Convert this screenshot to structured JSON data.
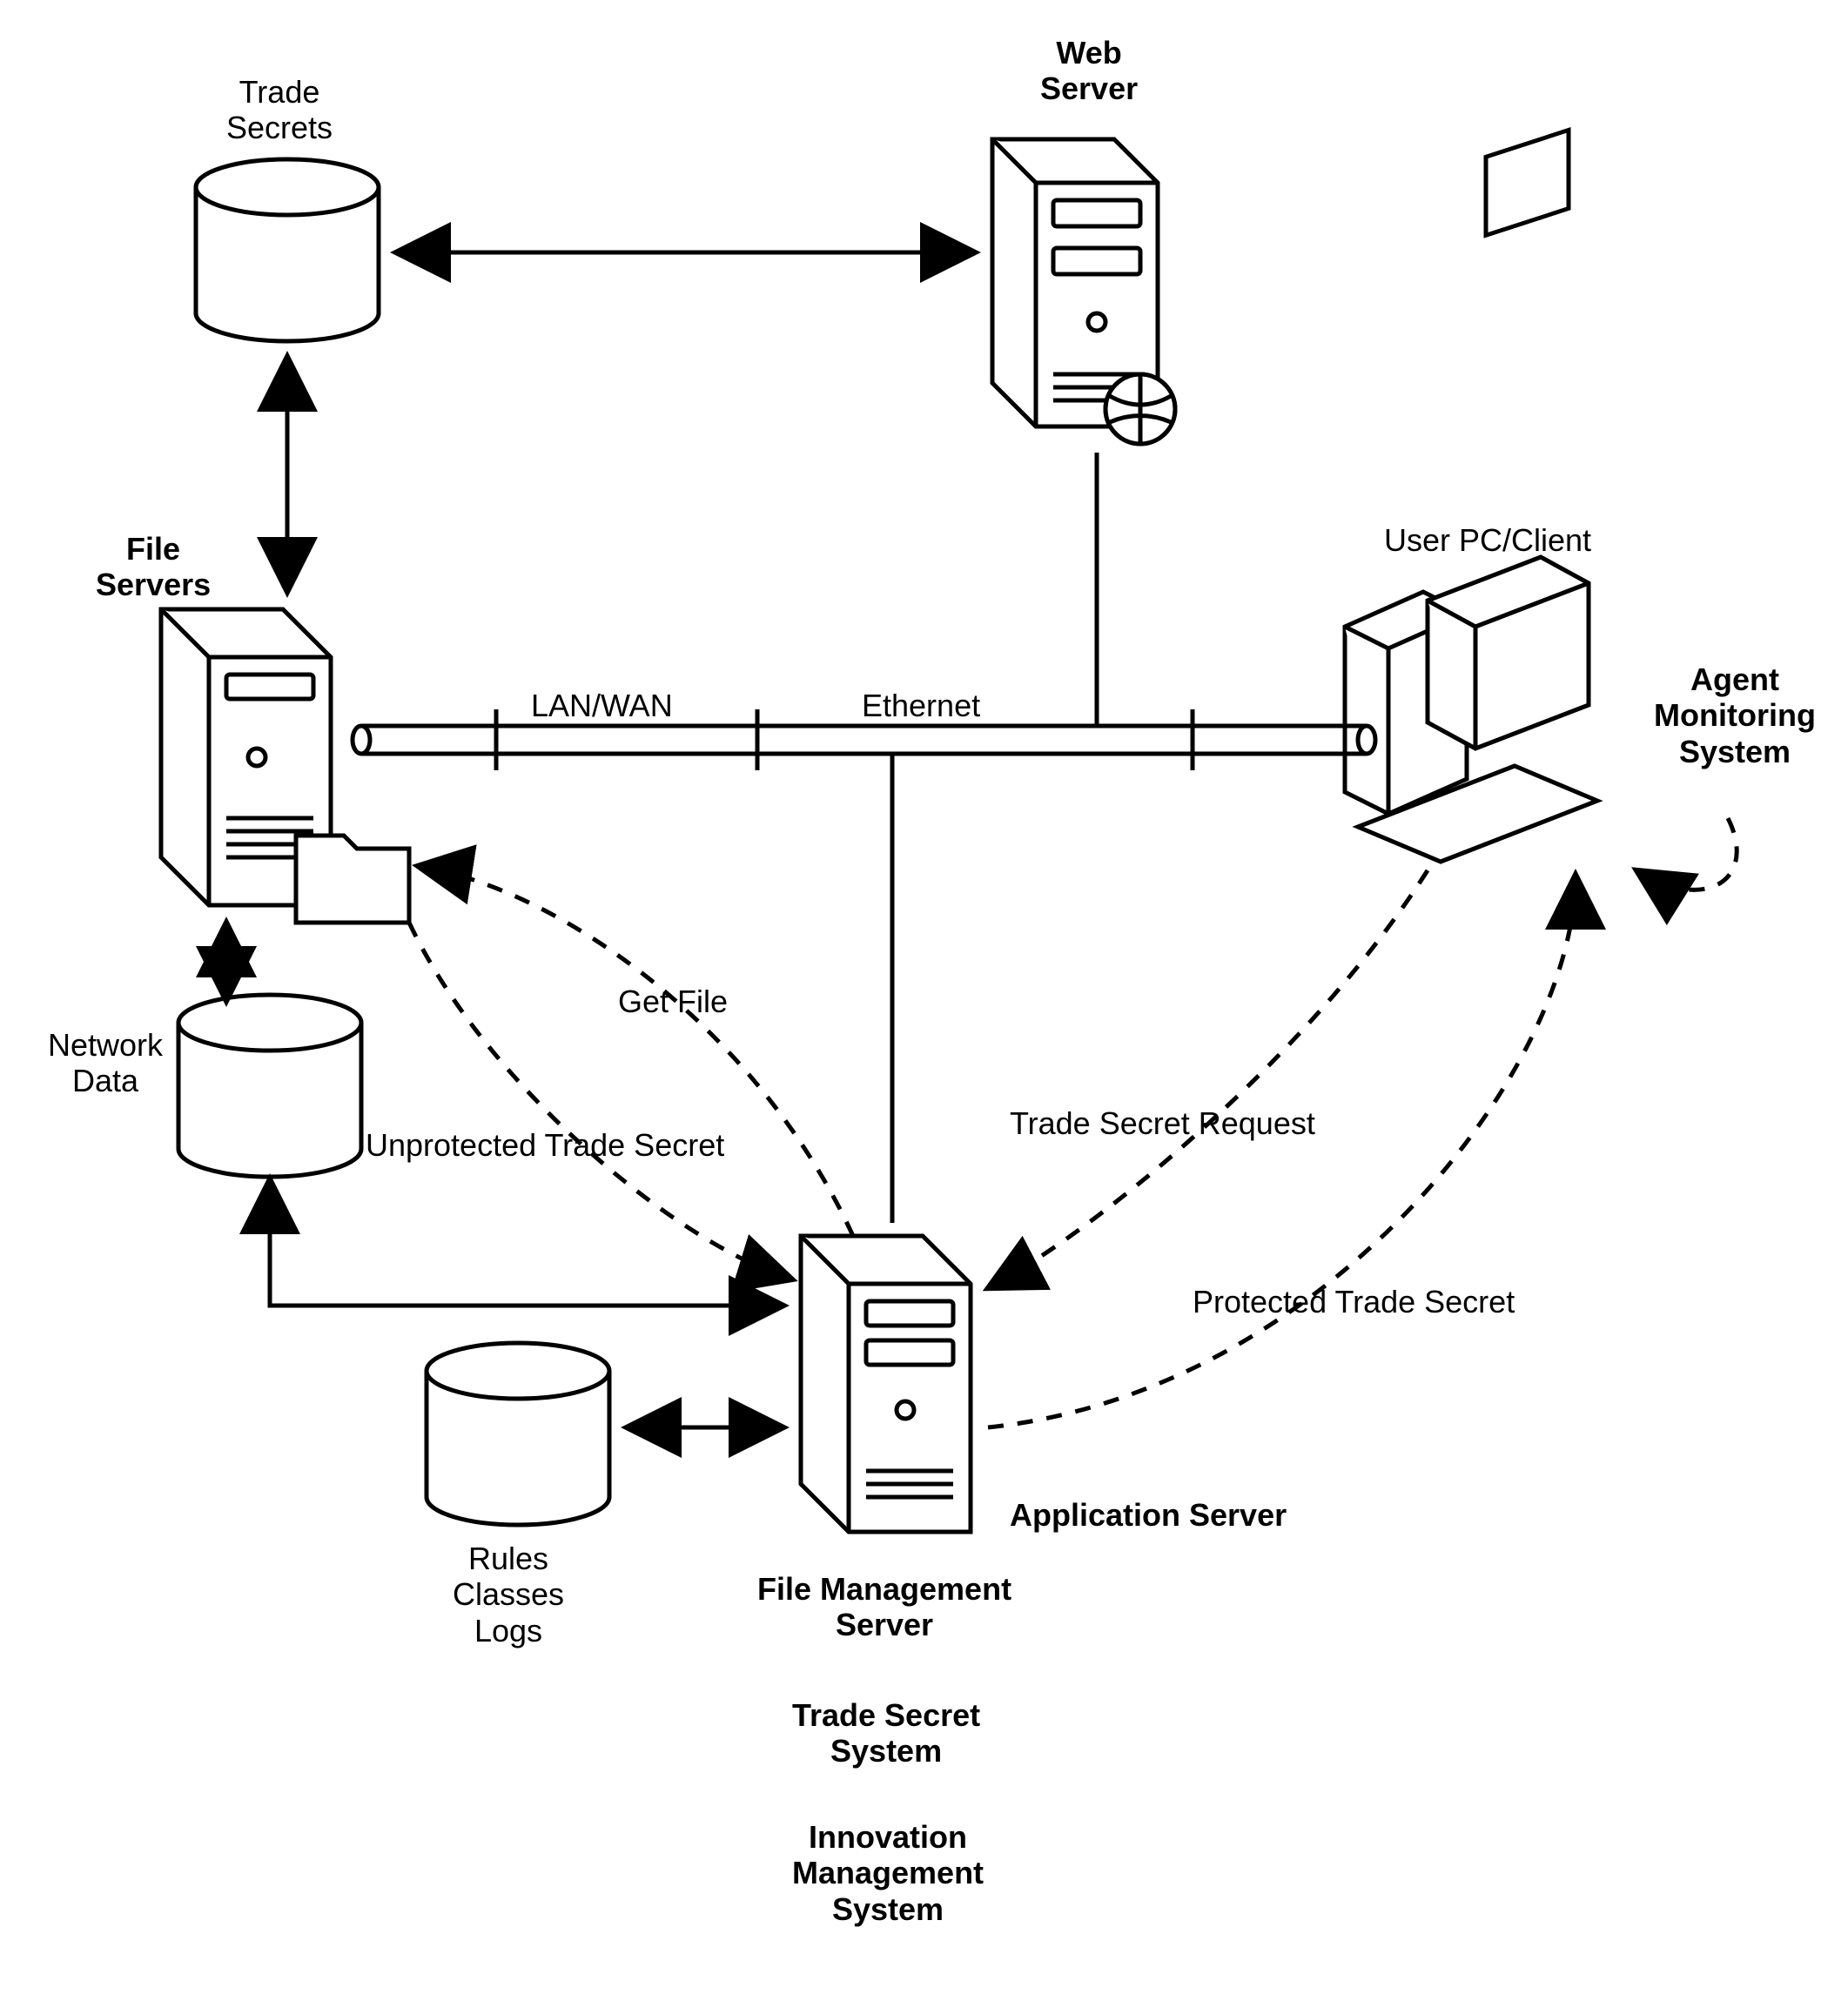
{
  "labels": {
    "tradeSecrets": "Trade\nSecrets",
    "webServer": "Web\nServer",
    "fileServers": "File\nServers",
    "userPcClient": "User PC/Client",
    "agentMonitoring": "Agent\nMonitoring\nSystem",
    "lanWan": "LAN/WAN",
    "ethernet": "Ethernet",
    "networkData": "Network\nData",
    "getFile": "Get File",
    "tradeSecretRequest": "Trade Secret Request",
    "unprotected": "Unprotected Trade Secret",
    "protected": "Protected Trade Secret",
    "applicationServer": "Application Server",
    "fileMgmtServer": "File Management\nServer",
    "rulesClassesLogs": "Rules\nClasses\nLogs",
    "tradeSecretSystem": "Trade Secret\nSystem",
    "innovationMgmt": "Innovation\nManagement\nSystem"
  }
}
